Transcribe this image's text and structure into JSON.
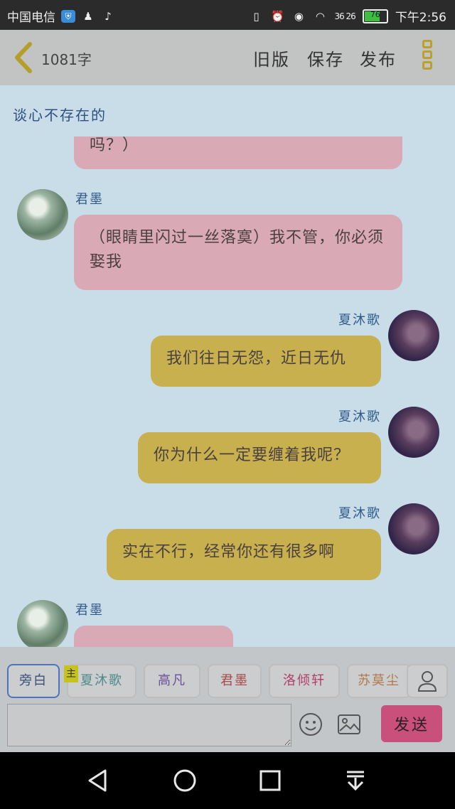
{
  "status_bar": {
    "carrier": "中国电信",
    "battery_level": "76",
    "battery_percent": 76,
    "network": "36 26",
    "time": "下午2:56"
  },
  "toolbar": {
    "word_count": "1081字",
    "old_version": "旧版",
    "save": "保存",
    "publish": "发布"
  },
  "chat": {
    "title": "谈心不存在的",
    "messages": [
      {
        "side": "left",
        "name": "",
        "text": "吗？）",
        "color": "#d9a9b6"
      },
      {
        "side": "left",
        "name": "君墨",
        "text": "（眼睛里闪过一丝落寞）我不管，你必须娶我",
        "color": "#d9a9b6"
      },
      {
        "side": "right",
        "name": "夏沐歌",
        "text": "我们往日无怨，近日无仇",
        "color": "#c8b04e"
      },
      {
        "side": "right",
        "name": "夏沐歌",
        "text": "你为什么一定要缠着我呢？",
        "color": "#c8b04e"
      },
      {
        "side": "right",
        "name": "夏沐歌",
        "text": "实在不行，经常你还有很多啊",
        "color": "#c8b04e"
      },
      {
        "side": "left",
        "name": "君墨",
        "text": "",
        "color": "#d9a9b6"
      }
    ]
  },
  "role_selector": {
    "main_tag": "主",
    "roles": [
      {
        "label": "旁白",
        "color": "#3a4f7a"
      },
      {
        "label": "夏沐歌",
        "color": "#4f8a8a"
      },
      {
        "label": "高凡",
        "color": "#6a4f9a"
      },
      {
        "label": "君墨",
        "color": "#a64a4a"
      },
      {
        "label": "洛倾轩",
        "color": "#b0406a"
      },
      {
        "label": "苏莫尘",
        "color": "#b07a4a"
      }
    ]
  },
  "input": {
    "placeholder": "",
    "send_label": "发送"
  },
  "nav": {
    "icons": [
      "back-icon",
      "home-icon",
      "recents-icon",
      "notification-pull-icon"
    ]
  }
}
